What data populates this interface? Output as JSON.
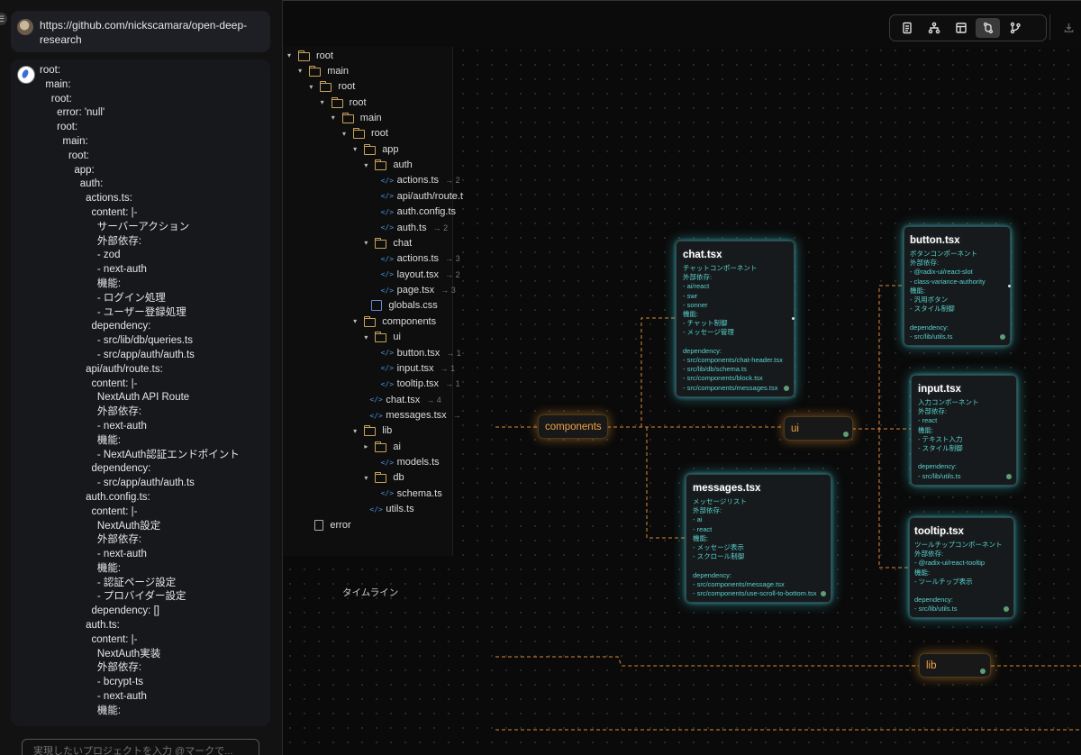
{
  "chat": {
    "user_url": "https://github.com/nickscamara/open-deep-research",
    "yaml_lines": [
      "root:",
      "  main:",
      "    root:",
      "      error: 'null'",
      "      root:",
      "        main:",
      "          root:",
      "            app:",
      "              auth:",
      "                actions.ts:",
      "                  content: |-",
      "                    サーバーアクション",
      "                    外部依存:",
      "                    - zod",
      "                    - next-auth",
      "                    機能:",
      "                    - ログイン処理",
      "                    - ユーザー登録処理",
      "                  dependency:",
      "                    - src/lib/db/queries.ts",
      "                    - src/app/auth/auth.ts",
      "                api/auth/route.ts:",
      "                  content: |-",
      "                    NextAuth API Route",
      "                    外部依存:",
      "                    - next-auth",
      "                    機能:",
      "                    - NextAuth認証エンドポイント",
      "                  dependency:",
      "                    - src/app/auth/auth.ts",
      "                auth.config.ts:",
      "                  content: |-",
      "                    NextAuth設定",
      "                    外部依存:",
      "                    - next-auth",
      "                    機能:",
      "                    - 認証ページ設定",
      "                    - プロバイダー設定",
      "                  dependency: []",
      "                auth.ts:",
      "                  content: |-",
      "                    NextAuth実装",
      "                    外部依存:",
      "                    - bcrypt-ts",
      "                    - next-auth",
      "                    機能:"
    ],
    "input_placeholder": "実現したいプロジェクトを入力 @マークで..."
  },
  "toolbar": {
    "buttons": [
      "document-icon",
      "hierarchy-icon",
      "layout-icon",
      "flow-icon",
      "branch-icon",
      "download-icon"
    ],
    "active": "flow-icon"
  },
  "tree": {
    "rows": [
      {
        "label": "root",
        "type": "folder",
        "depth": 0,
        "open": true
      },
      {
        "label": "main",
        "type": "folder",
        "depth": 1,
        "open": true
      },
      {
        "label": "root",
        "type": "folder",
        "depth": 2,
        "open": true
      },
      {
        "label": "root",
        "type": "folder",
        "depth": 3,
        "open": true
      },
      {
        "label": "main",
        "type": "folder",
        "depth": 4,
        "open": true
      },
      {
        "label": "root",
        "type": "folder",
        "depth": 5,
        "open": true
      },
      {
        "label": "app",
        "type": "folder",
        "depth": 6,
        "open": true
      },
      {
        "label": "auth",
        "type": "folder",
        "depth": 7,
        "open": true
      },
      {
        "label": "actions.ts",
        "type": "code",
        "depth": 8,
        "meta": "→ 2"
      },
      {
        "label": "api/auth/route.t",
        "type": "code",
        "depth": 8,
        "meta": ""
      },
      {
        "label": "auth.config.ts",
        "type": "code",
        "depth": 8,
        "meta": ""
      },
      {
        "label": "auth.ts",
        "type": "code",
        "depth": 8,
        "meta": "→ 2"
      },
      {
        "label": "chat",
        "type": "folder",
        "depth": 7,
        "open": true
      },
      {
        "label": "actions.ts",
        "type": "code",
        "depth": 8,
        "meta": "→ 3"
      },
      {
        "label": "layout.tsx",
        "type": "code",
        "depth": 8,
        "meta": "→ 2"
      },
      {
        "label": "page.tsx",
        "type": "code",
        "depth": 8,
        "meta": "→ 3"
      },
      {
        "label": "globals.css",
        "type": "css",
        "depth": 7,
        "meta": ""
      },
      {
        "label": "components",
        "type": "folder",
        "depth": 6,
        "open": true
      },
      {
        "label": "ui",
        "type": "folder",
        "depth": 7,
        "open": true
      },
      {
        "label": "button.tsx",
        "type": "code",
        "depth": 8,
        "meta": "→ 1"
      },
      {
        "label": "input.tsx",
        "type": "code",
        "depth": 8,
        "meta": "→ 1"
      },
      {
        "label": "tooltip.tsx",
        "type": "code",
        "depth": 8,
        "meta": "→ 1"
      },
      {
        "label": "chat.tsx",
        "type": "code",
        "depth": 7,
        "meta": "→ 4"
      },
      {
        "label": "messages.tsx",
        "type": "code",
        "depth": 7,
        "meta": "→"
      },
      {
        "label": "lib",
        "type": "folder",
        "depth": 6,
        "open": true
      },
      {
        "label": "ai",
        "type": "folder",
        "depth": 7,
        "open": false
      },
      {
        "label": "models.ts",
        "type": "code",
        "depth": 8,
        "meta": ""
      },
      {
        "label": "db",
        "type": "folder",
        "depth": 7,
        "open": true
      },
      {
        "label": "schema.ts",
        "type": "code",
        "depth": 8,
        "meta": ""
      },
      {
        "label": "utils.ts",
        "type": "code",
        "depth": 7,
        "meta": ""
      },
      {
        "label": "error",
        "type": "doc",
        "depth": 2,
        "meta": ""
      }
    ],
    "timeline_label": "タイムライン"
  },
  "graph": {
    "group_nodes": [
      {
        "id": "components",
        "label": "components"
      },
      {
        "id": "ui",
        "label": "ui"
      },
      {
        "id": "lib",
        "label": "lib"
      }
    ],
    "file_cards": [
      {
        "id": "chat",
        "title": "chat.tsx",
        "body": "チャットコンポーネント\n外部依存:\n- ai/react\n- swr\n- sonner\n機能:\n- チャット制御\n- メッセージ管理\n\ndependency:\n- src/components/chat-header.tsx\n- src/lib/db/schema.ts\n- src/components/block.tsx\n- src/components/messages.tsx"
      },
      {
        "id": "messages",
        "title": "messages.tsx",
        "body": "メッセージリスト\n外部依存:\n- ai\n- react\n機能:\n- メッセージ表示\n- スクロール制御\n\ndependency:\n- src/components/message.tsx\n- src/components/use-scroll-to-bottom.tsx"
      },
      {
        "id": "button",
        "title": "button.tsx",
        "body": "ボタンコンポーネント\n外部依存:\n- @radix-ui/react-slot\n- class-variance-authority\n機能:\n- 汎用ボタン\n- スタイル制御\n\ndependency:\n- src/lib/utils.ts"
      },
      {
        "id": "input",
        "title": "input.tsx",
        "body": "入力コンポーネント\n外部依存:\n- react\n機能:\n- テキスト入力\n- スタイル制御\n\ndependency:\n- src/lib/utils.ts"
      },
      {
        "id": "tooltip",
        "title": "tooltip.tsx",
        "body": "ツールチップコンポーネント\n外部依存:\n- @radix-ui/react-tooltip\n機能:\n- ツールチップ表示\n\ndependency:\n- src/lib/utils.ts"
      }
    ],
    "colors": {
      "card_glow": "#46c8d2",
      "group_glow": "#e69632",
      "edge": "#d98a3a",
      "body_text": "#5bd1cf",
      "status_dot": "#5d9e74"
    }
  }
}
